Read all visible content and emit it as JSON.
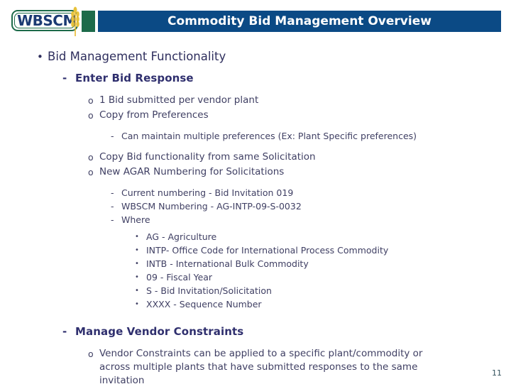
{
  "header": {
    "logo_text": "WBSCM",
    "logo_icon": "wheat-stalk-icon",
    "title": "Commodity Bid Management Overview",
    "colors": {
      "title_bar": "#0b4a85",
      "green_block": "#1d6b4a",
      "logo_text": "#1b3a73",
      "wheat": "#e8b92e"
    }
  },
  "slide": {
    "markers": {
      "bullet_dot": "•",
      "dash": "-",
      "circle": "o"
    },
    "outline": [
      {
        "level": 1,
        "marker": "•",
        "text": "Bid Management Functionality"
      },
      {
        "level": 2,
        "marker": "-",
        "text": "Enter Bid Response"
      },
      {
        "level": 3,
        "marker": "o",
        "text": "1 Bid submitted per vendor plant"
      },
      {
        "level": 3,
        "marker": "o",
        "text": "Copy from Preferences"
      },
      {
        "level": 4,
        "marker": "-",
        "text": "Can maintain multiple preferences (Ex: Plant Specific preferences)"
      },
      {
        "level": 3,
        "marker": "o",
        "text": "Copy Bid functionality from same Solicitation"
      },
      {
        "level": 3,
        "marker": "o",
        "text": "New AGAR Numbering for Solicitations"
      },
      {
        "level": 4,
        "marker": "-",
        "text": "Current numbering  - Bid Invitation 019"
      },
      {
        "level": 4,
        "marker": "-",
        "text": "WBSCM Numbering - AG-INTP-09-S-0032"
      },
      {
        "level": 4,
        "marker": "-",
        "text": "Where"
      },
      {
        "level": 5,
        "marker": "•",
        "text": "AG - Agriculture"
      },
      {
        "level": 5,
        "marker": "•",
        "text": "INTP- Office Code for International Process Commodity"
      },
      {
        "level": 5,
        "marker": "•",
        "text": "INTB - International Bulk Commodity"
      },
      {
        "level": 5,
        "marker": "•",
        "text": "09 - Fiscal Year"
      },
      {
        "level": 5,
        "marker": "•",
        "text": "S - Bid Invitation/Solicitation"
      },
      {
        "level": 5,
        "marker": "•",
        "text": "XXXX - Sequence Number"
      },
      {
        "level": 2,
        "marker": "-",
        "text": "Manage Vendor Constraints"
      },
      {
        "level": 3,
        "marker": "o",
        "text": "Vendor Constraints can be applied to a specific plant/commodity or across multiple plants that have submitted responses to the same invitation"
      }
    ]
  },
  "footer": {
    "page_number": "11"
  }
}
